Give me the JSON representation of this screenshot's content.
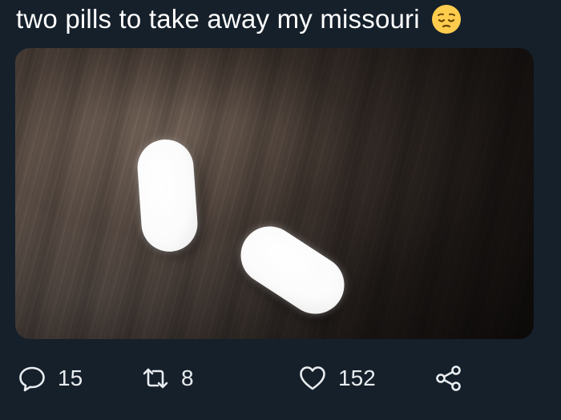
{
  "tweet": {
    "text": "two pills to take away my missouri",
    "emoji": "pensive-face-emoji"
  },
  "media": {
    "description_icon": "photo"
  },
  "actions": {
    "reply": {
      "icon": "reply-icon",
      "count": "15"
    },
    "retweet": {
      "icon": "retweet-icon",
      "count": "8"
    },
    "like": {
      "icon": "heart-icon",
      "count": "152"
    },
    "share": {
      "icon": "share-icon"
    }
  },
  "colors": {
    "background": "#15202b",
    "text": "#ffffff",
    "icon": "#e9edf0",
    "emoji": "#ffcc4d"
  }
}
